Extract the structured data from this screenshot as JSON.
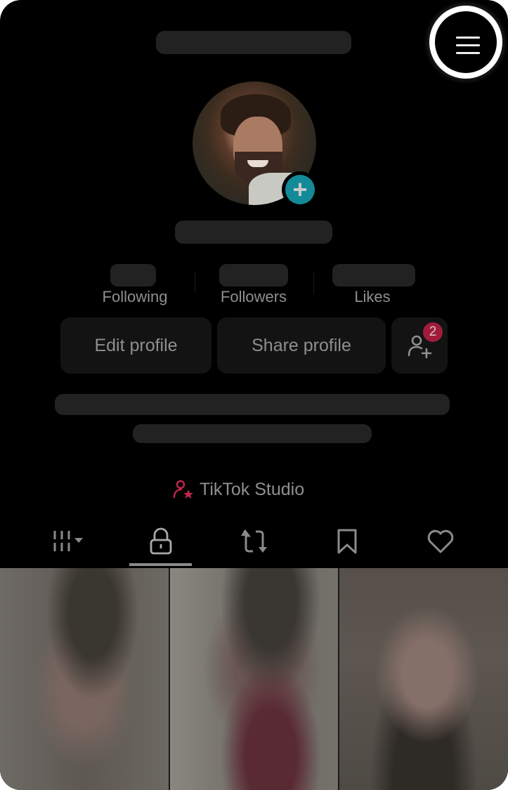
{
  "profile": {
    "username_redacted": "",
    "display_name_redacted": "",
    "avatar_action_icon": "plus-icon",
    "stats": [
      {
        "label": "Following",
        "value_redacted": ""
      },
      {
        "label": "Followers",
        "value_redacted": ""
      },
      {
        "label": "Likes",
        "value_redacted": ""
      }
    ],
    "bio_lines_redacted": [
      "",
      ""
    ]
  },
  "header": {
    "menu_icon": "hamburger-menu-icon"
  },
  "actions": {
    "edit_profile": "Edit profile",
    "share_profile": "Share profile",
    "add_friends_badge": "2"
  },
  "studio": {
    "label": "TikTok Studio",
    "icon_color": "#c0264a"
  },
  "tabs": [
    {
      "icon": "videos-grid-icon",
      "active": false
    },
    {
      "icon": "lock-icon",
      "active": true
    },
    {
      "icon": "repost-icon",
      "active": false
    },
    {
      "icon": "bookmark-icon",
      "active": false
    },
    {
      "icon": "heart-icon",
      "active": false
    }
  ],
  "colors": {
    "background": "#000000",
    "skeleton": "#222222",
    "button_bg": "#131313",
    "text_muted": "#8f8f8f",
    "accent_teal": "#138a98",
    "badge_red": "#a11c3b"
  },
  "videos": [
    {
      "thumbnail": "blurred"
    },
    {
      "thumbnail": "blurred"
    },
    {
      "thumbnail": "blurred"
    }
  ]
}
